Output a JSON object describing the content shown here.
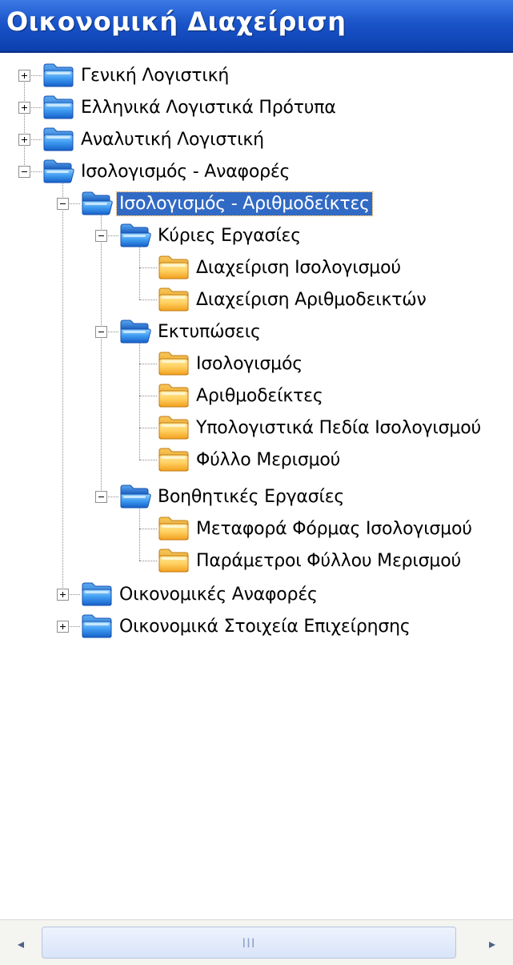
{
  "window": {
    "title": "Οικονομική Διαχείριση"
  },
  "tree": {
    "nodes": [
      {
        "label": "Γενική Λογιστική"
      },
      {
        "label": "Ελληνικά Λογιστικά Πρότυπα"
      },
      {
        "label": "Αναλυτική Λογιστική"
      },
      {
        "label": "Ισολογισμός - Αναφορές"
      },
      {
        "label": "Ισολογισμός - Αριθμοδείκτες"
      },
      {
        "label": "Κύριες Εργασίες"
      },
      {
        "label": "Διαχείριση Ισολογισμού"
      },
      {
        "label": "Διαχείριση Αριθμοδεικτών"
      },
      {
        "label": "Εκτυπώσεις"
      },
      {
        "label": "Ισολογισμός"
      },
      {
        "label": "Αριθμοδείκτες"
      },
      {
        "label": "Υπολογιστικά Πεδία Ισολογισμού"
      },
      {
        "label": "Φύλλο Μερισμού"
      },
      {
        "label": "Βοηθητικές Εργασίες"
      },
      {
        "label": "Μεταφορά Φόρμας Ισολογισμού"
      },
      {
        "label": "Παράμετροι Φύλλου Μερισμού"
      },
      {
        "label": "Οικονομικές Αναφορές"
      },
      {
        "label": "Οικονομικά Στοιχεία Επιχείρησης"
      }
    ],
    "selected": "Ισολογισμός - Αριθμοδείκτες"
  },
  "scrollbar": {
    "left_arrow": "◂",
    "right_arrow": "▸",
    "grip": "III"
  },
  "colors": {
    "titlebar": "#1a54c9",
    "selection": "#316ac5",
    "folder_blue": "#2d7fe0",
    "folder_yellow": "#f6b733"
  },
  "icons": {
    "closed_blue": "folder-closed-icon",
    "open_blue": "folder-open-icon",
    "yellow_leaf": "folder-item-icon"
  }
}
